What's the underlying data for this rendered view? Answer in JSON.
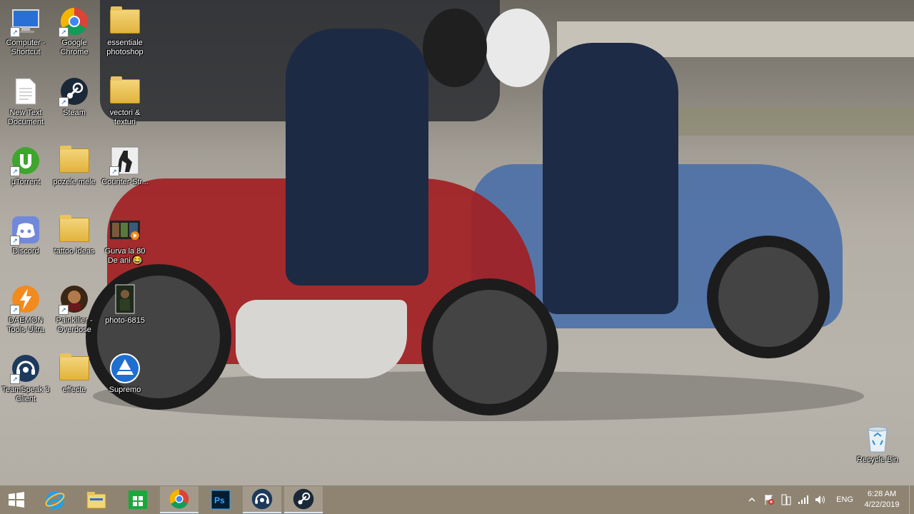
{
  "desktop": {
    "icons": [
      {
        "label": "Computer - Shortcut",
        "icon": "computer-icon"
      },
      {
        "label": "Google Chrome",
        "icon": "chrome-icon"
      },
      {
        "label": "essentiale photoshop",
        "icon": "folder-icon"
      },
      {
        "label": "New Text Document",
        "icon": "text-document-icon"
      },
      {
        "label": "Steam",
        "icon": "steam-icon"
      },
      {
        "label": "vectori & texturi",
        "icon": "folder-icon"
      },
      {
        "label": "µTorrent",
        "icon": "utorrent-icon"
      },
      {
        "label": "pozele mele",
        "icon": "folder-icon"
      },
      {
        "label": "Counter-Str...",
        "icon": "counter-strike-icon"
      },
      {
        "label": "Discord",
        "icon": "discord-icon"
      },
      {
        "label": "tattoo ideas",
        "icon": "folder-icon"
      },
      {
        "label": "Gurva la 80 De ani 😂",
        "icon": "video-file-icon"
      },
      {
        "label": "DAEMON Tools Ultra",
        "icon": "daemon-tools-icon"
      },
      {
        "label": "Painkiller - Overdose",
        "icon": "painkiller-icon"
      },
      {
        "label": "photo-6815",
        "icon": "photo-file-icon"
      },
      {
        "label": "TeamSpeak 3 Client",
        "icon": "teamspeak-icon"
      },
      {
        "label": "effecte",
        "icon": "folder-icon"
      },
      {
        "label": "Supremo",
        "icon": "supremo-icon"
      }
    ],
    "recycle_bin": {
      "label": "Recycle Bin",
      "icon": "recycle-bin-icon"
    }
  },
  "taskbar": {
    "start": {
      "icon": "windows-logo-icon"
    },
    "apps": [
      {
        "name": "Internet Explorer",
        "icon": "internet-explorer-icon",
        "active": false
      },
      {
        "name": "File Explorer",
        "icon": "file-explorer-icon",
        "active": false
      },
      {
        "name": "Store",
        "icon": "store-icon",
        "active": false
      },
      {
        "name": "Google Chrome",
        "icon": "chrome-icon",
        "active": true
      },
      {
        "name": "Photoshop",
        "icon": "photoshop-icon",
        "active": false
      },
      {
        "name": "TeamSpeak 3",
        "icon": "teamspeak-icon",
        "active": true
      },
      {
        "name": "Steam",
        "icon": "steam-icon",
        "active": true
      }
    ],
    "tray": {
      "icons": [
        "chevron-up-icon",
        "flag-error-icon",
        "device-icon",
        "network-signal-icon",
        "volume-icon"
      ],
      "language": "ENG",
      "time": "6:28 AM",
      "date": "4/22/2019"
    }
  },
  "colors": {
    "taskbar": "#8c806e",
    "chrome_red": "#db4437",
    "chrome_green": "#0f9d58",
    "chrome_yellow": "#f4b400",
    "chrome_blue": "#4285f4",
    "discord": "#7289da",
    "steam": "#1b2838",
    "photoshop": "#001d34",
    "store_green": "#1ba83b",
    "daemon_orange": "#f28b1d"
  }
}
